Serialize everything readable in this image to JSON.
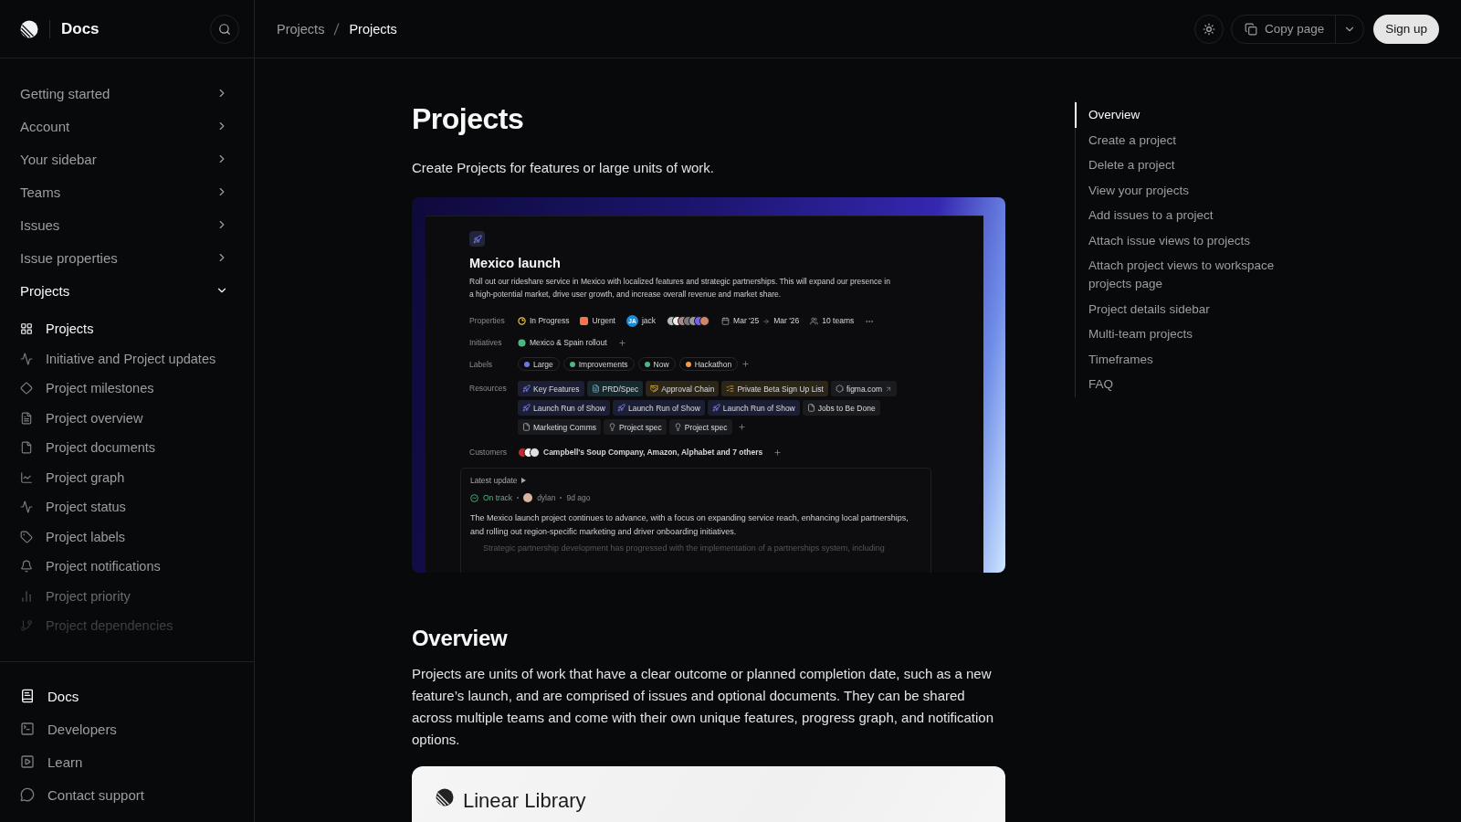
{
  "sidebar": {
    "brand": "Docs",
    "sections": [
      {
        "label": "Getting started",
        "expanded": false
      },
      {
        "label": "Account",
        "expanded": false
      },
      {
        "label": "Your sidebar",
        "expanded": false
      },
      {
        "label": "Teams",
        "expanded": false
      },
      {
        "label": "Issues",
        "expanded": false
      },
      {
        "label": "Issue properties",
        "expanded": false
      },
      {
        "label": "Projects",
        "expanded": true,
        "children": [
          {
            "label": "Projects",
            "selected": true
          },
          {
            "label": "Initiative and Project updates",
            "selected": false
          },
          {
            "label": "Project milestones",
            "selected": false
          },
          {
            "label": "Project overview",
            "selected": false
          },
          {
            "label": "Project documents",
            "selected": false
          },
          {
            "label": "Project graph",
            "selected": false
          },
          {
            "label": "Project status",
            "selected": false
          },
          {
            "label": "Project labels",
            "selected": false
          },
          {
            "label": "Project notifications",
            "selected": false
          },
          {
            "label": "Project priority",
            "selected": false
          },
          {
            "label": "Project dependencies",
            "selected": false
          }
        ]
      }
    ],
    "footer": [
      {
        "label": "Docs",
        "selected": true
      },
      {
        "label": "Developers",
        "selected": false
      },
      {
        "label": "Learn",
        "selected": false
      },
      {
        "label": "Contact support",
        "selected": false
      }
    ]
  },
  "header": {
    "breadcrumbs": [
      {
        "label": "Projects",
        "current": false
      },
      {
        "label": "Projects",
        "current": true
      }
    ],
    "copy_button": "Copy page",
    "signup_button": "Sign up"
  },
  "page": {
    "title": "Projects",
    "lead": "Create Projects for features or large units of work.",
    "hero": {
      "title": "Mexico launch",
      "description": "Roll out our rideshare service in Mexico with localized features and strategic partnerships. This will expand our presence in a high-potential market, drive user growth, and increase overall revenue and market share.",
      "properties": {
        "label": "Properties",
        "status": "In Progress",
        "priority": "Urgent",
        "lead_initials": "JA",
        "lead": "jack",
        "start": "Mar '25",
        "end": "Mar '26",
        "teams": "10 teams"
      },
      "initiatives": {
        "label": "Initiatives",
        "items": [
          "Mexico & Spain rollout"
        ]
      },
      "labels": {
        "label": "Labels",
        "items": [
          {
            "name": "Large",
            "color": "#6c78e0"
          },
          {
            "name": "Improvements",
            "color": "#4cb782"
          },
          {
            "name": "Now",
            "color": "#4cb782"
          },
          {
            "name": "Hackathon",
            "color": "#f2994a"
          }
        ]
      },
      "resources": {
        "label": "Resources",
        "items": [
          {
            "name": "Key Features",
            "kind": "project"
          },
          {
            "name": "PRD/Spec",
            "kind": "spec"
          },
          {
            "name": "Approval Chain",
            "kind": "deal"
          },
          {
            "name": "Private Beta Sign Up List",
            "kind": "list"
          },
          {
            "name": "figma.com",
            "kind": "link"
          },
          {
            "name": "Launch Run of Show",
            "kind": "project"
          },
          {
            "name": "Launch Run of Show",
            "kind": "project"
          },
          {
            "name": "Launch Run of Show",
            "kind": "project"
          },
          {
            "name": "Jobs to Be Done",
            "kind": "doc"
          },
          {
            "name": "Marketing Comms",
            "kind": "doc"
          },
          {
            "name": "Project spec",
            "kind": "idea"
          },
          {
            "name": "Project spec",
            "kind": "idea"
          }
        ]
      },
      "customers": {
        "label": "Customers",
        "text": "Campbell's Soup Company, Amazon, Alphabet and 7 others"
      },
      "update": {
        "label": "Latest update",
        "status": "On track",
        "author": "dylan",
        "age": "9d ago",
        "body": "The Mexico launch project continues to advance, with a focus on expanding service reach, enhancing local partnerships, and rolling out region-specific marketing and driver onboarding initiatives.",
        "bullets": [
          "Strategic partnership development has progressed with the implementation of a partnerships system, including"
        ]
      }
    },
    "sections": [
      {
        "heading": "Overview",
        "body": "Projects are units of work that have a clear outcome or planned completion date, such as a new feature’s launch, and are comprised of issues and optional documents. They can be shared across multiple teams and come with their own unique features, progress graph, and notification options."
      }
    ],
    "library_card": {
      "title": "Linear Library"
    }
  },
  "toc": [
    {
      "label": "Overview",
      "selected": true
    },
    {
      "label": "Create a project",
      "selected": false
    },
    {
      "label": "Delete a project",
      "selected": false
    },
    {
      "label": "View your projects",
      "selected": false
    },
    {
      "label": "Add issues to a project",
      "selected": false
    },
    {
      "label": "Attach issue views to projects",
      "selected": false
    },
    {
      "label": "Attach project views to workspace projects page",
      "selected": false
    },
    {
      "label": "Project details sidebar",
      "selected": false
    },
    {
      "label": "Multi-team projects",
      "selected": false
    },
    {
      "label": "Timeframes",
      "selected": false
    },
    {
      "label": "FAQ",
      "selected": false
    }
  ]
}
